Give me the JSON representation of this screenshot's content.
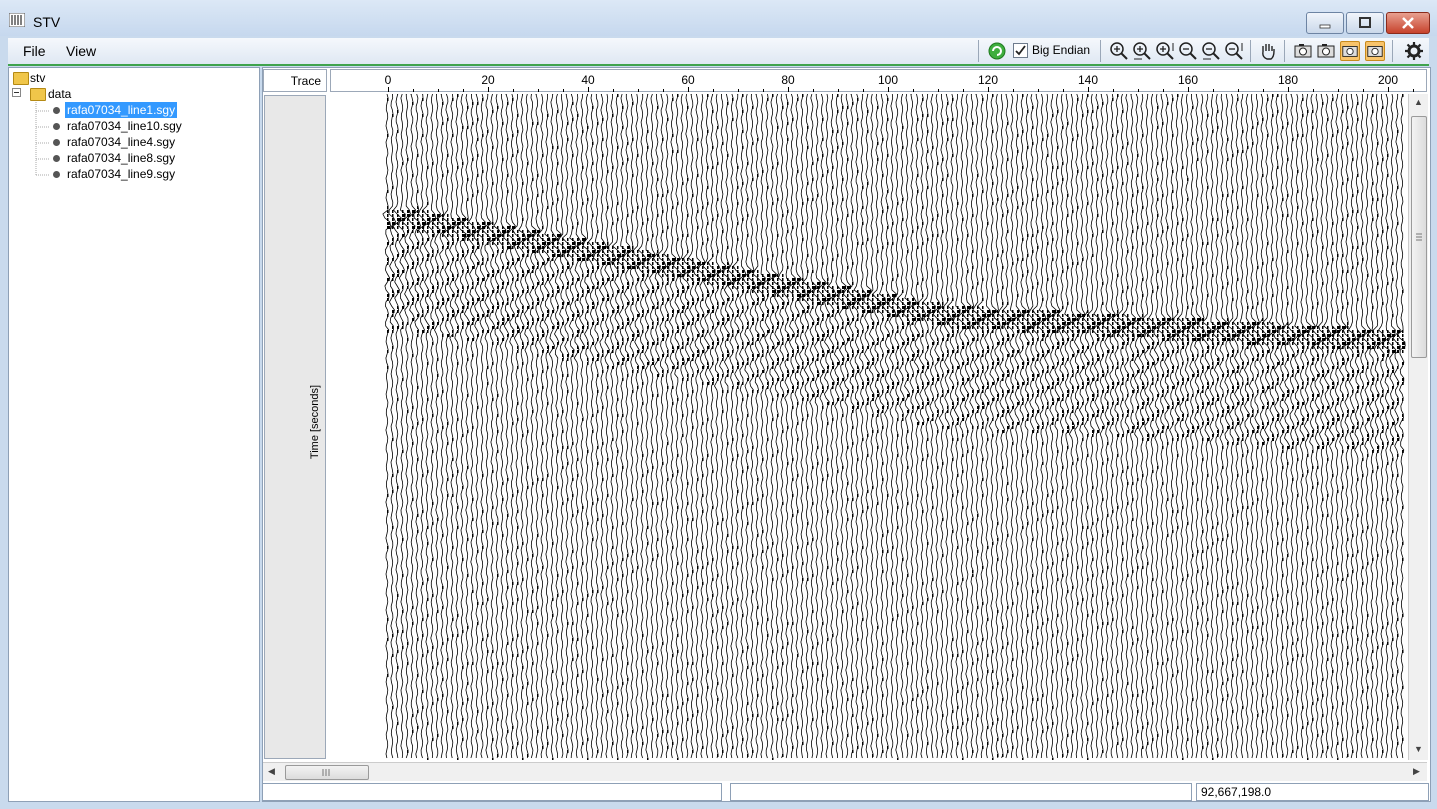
{
  "window": {
    "title": "STV"
  },
  "menu": {
    "file": "File",
    "view": "View"
  },
  "toolbar": {
    "big_endian_label": "Big Endian",
    "big_endian_checked": true,
    "icons": [
      "refresh-icon",
      "zoom-in-icon",
      "zoom-in-x-icon",
      "zoom-in-y-icon",
      "zoom-out-icon",
      "zoom-out-x-icon",
      "zoom-out-y-icon",
      "pan-hand-icon",
      "camera-icon",
      "camera-alt-icon",
      "camera-highlight-icon",
      "camera-highlight-alt-icon",
      "settings-icon"
    ],
    "highlight_color": "#f8c46c"
  },
  "tree": {
    "root": "stv",
    "folder": "data",
    "files": [
      "rafa07034_line1.sgy",
      "rafa07034_line10.sgy",
      "rafa07034_line4.sgy",
      "rafa07034_line8.sgy",
      "rafa07034_line9.sgy"
    ],
    "selected_index": 0
  },
  "viewer": {
    "corner_label": "Trace",
    "y_axis_label": "Time [seconds]",
    "x_ticks": [
      "0",
      "20",
      "40",
      "60",
      "80",
      "100",
      "120",
      "140",
      "160",
      "180",
      "200"
    ]
  },
  "status": {
    "left": "",
    "middle": "",
    "right": "92,667,198.0"
  },
  "colors": {
    "accent_line": "#3fa34d",
    "selection": "#3399ff"
  }
}
